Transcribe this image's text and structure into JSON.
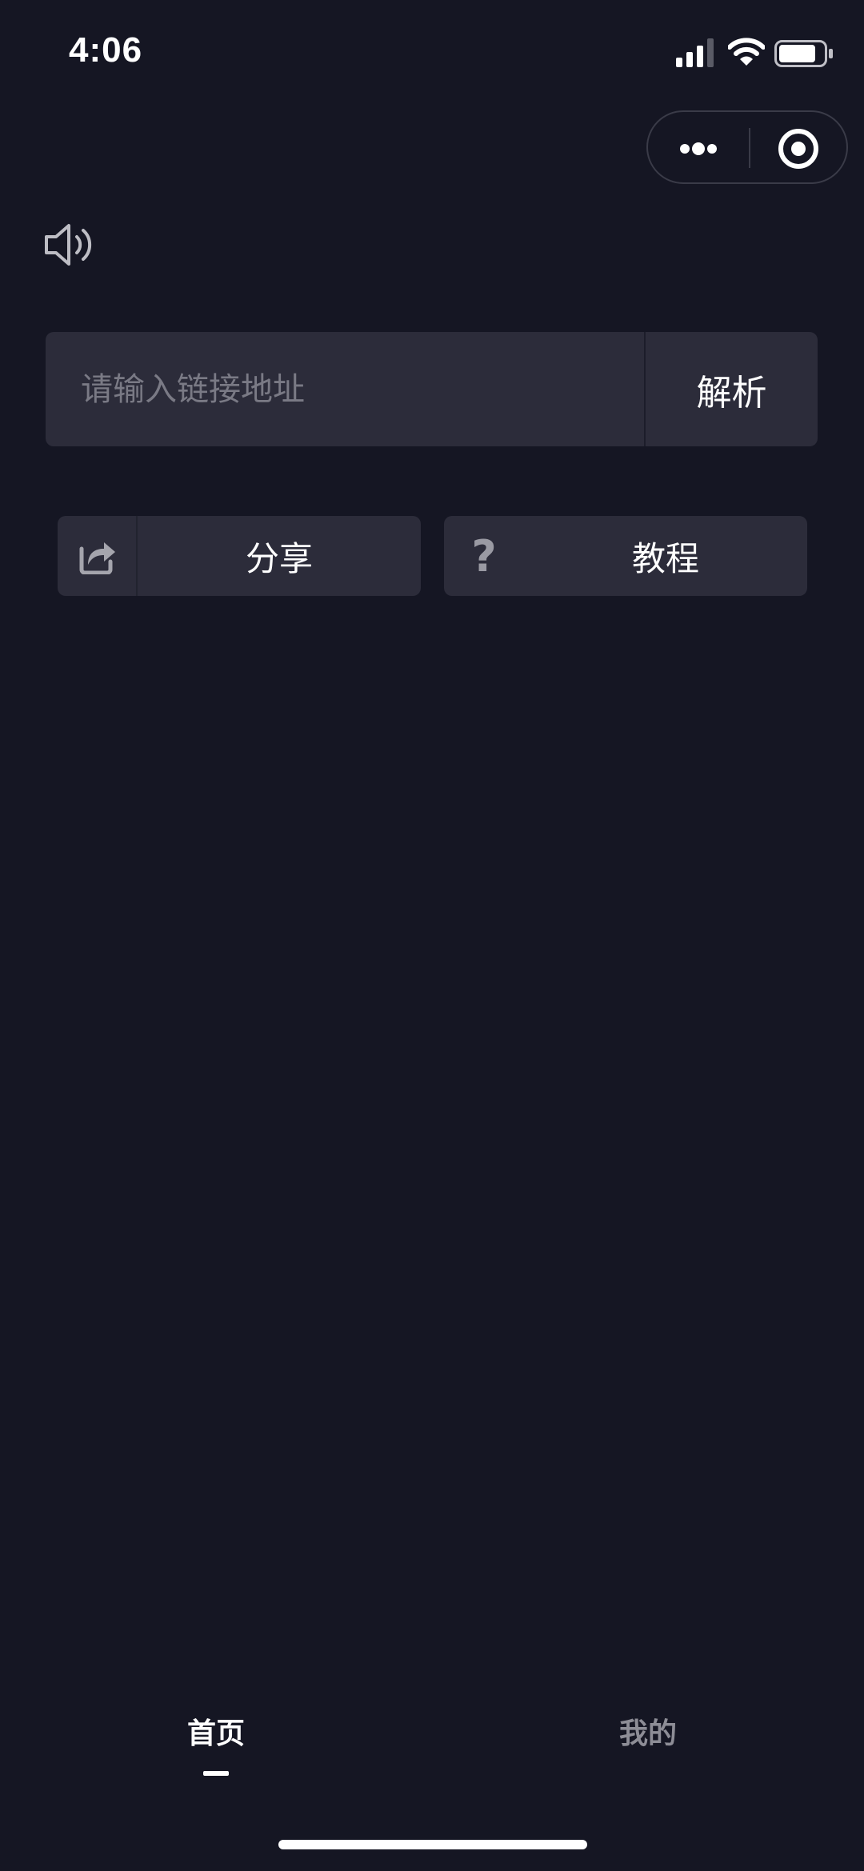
{
  "status_bar": {
    "time": "4:06",
    "icons": [
      "signal-icon",
      "wifi-icon",
      "battery-icon"
    ]
  },
  "capsule": {
    "icons": [
      "more-dots-icon",
      "close-target-icon"
    ]
  },
  "speaker": {
    "icon": "speaker-icon"
  },
  "search": {
    "placeholder": "请输入链接地址",
    "value": "",
    "button_label": "解析"
  },
  "actions": {
    "share_label": "分享",
    "share_icon": "share-icon",
    "tutorial_label": "教程",
    "tutorial_icon": "question-icon",
    "tutorial_glyph": "?"
  },
  "tabs": {
    "home_label": "首页",
    "mine_label": "我的",
    "active": "home"
  },
  "colors": {
    "background": "#151623",
    "surface": "#2c2c3a",
    "text": "#ffffff",
    "placeholder": "#7a7a85",
    "inactive_tab": "#8d8d96"
  }
}
